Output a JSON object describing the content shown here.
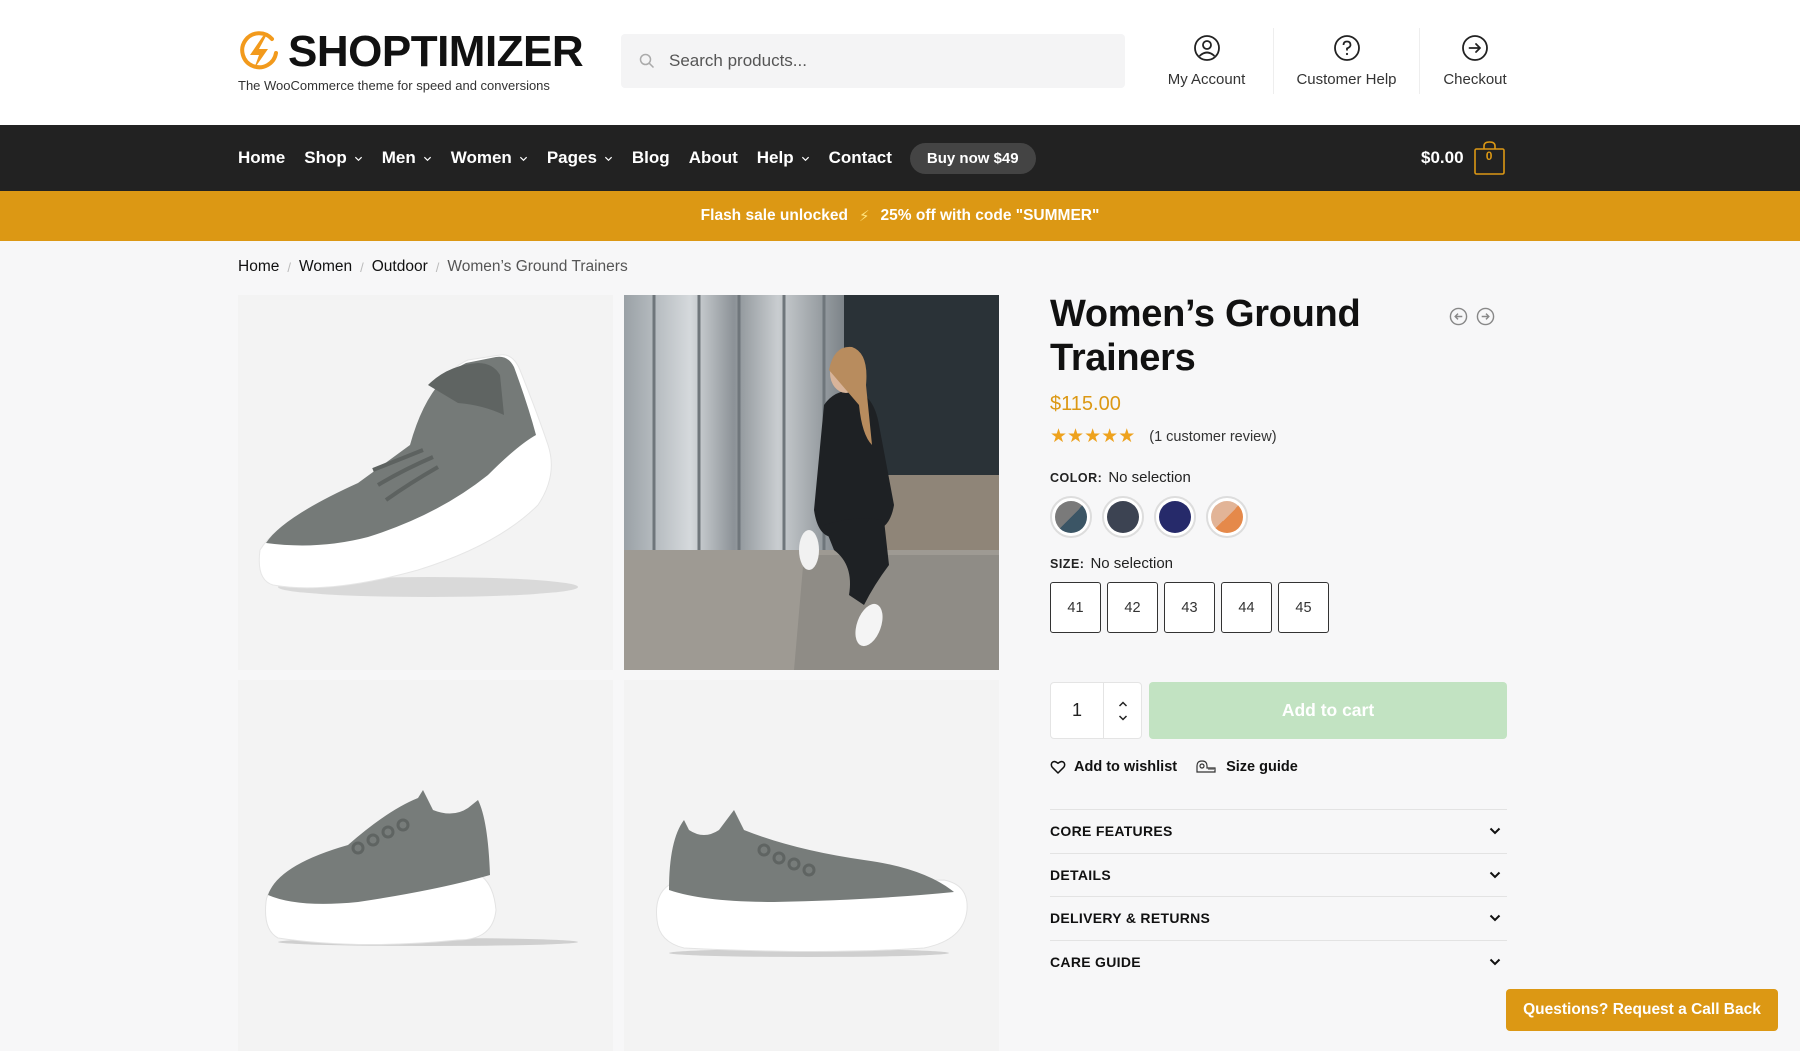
{
  "brand": {
    "name": "SHOPTIMIZER",
    "tagline": "The WooCommerce theme for speed and conversions",
    "logo_icon": "lightning-circle-icon",
    "accent_color": "#dc9814"
  },
  "search": {
    "placeholder": "Search products...",
    "value": "",
    "icon": "search-icon"
  },
  "header_links": [
    {
      "label": "My Account",
      "icon": "user-circle-icon"
    },
    {
      "label": "Customer Help",
      "icon": "help-circle-icon"
    },
    {
      "label": "Checkout",
      "icon": "arrow-right-circle-icon"
    }
  ],
  "nav": {
    "items": [
      {
        "label": "Home",
        "has_dropdown": false
      },
      {
        "label": "Shop",
        "has_dropdown": true
      },
      {
        "label": "Men",
        "has_dropdown": true
      },
      {
        "label": "Women",
        "has_dropdown": true
      },
      {
        "label": "Pages",
        "has_dropdown": true
      },
      {
        "label": "Blog",
        "has_dropdown": false
      },
      {
        "label": "About",
        "has_dropdown": false
      },
      {
        "label": "Help",
        "has_dropdown": true
      },
      {
        "label": "Contact",
        "has_dropdown": false
      }
    ],
    "buy_button": "Buy now $49",
    "cart_total": "$0.00",
    "cart_count": "0"
  },
  "flash_banner": {
    "left": "Flash sale unlocked",
    "icon": "⚡",
    "right": "25% off with code \"SUMMER\""
  },
  "breadcrumb": {
    "items": [
      "Home",
      "Women",
      "Outdoor"
    ],
    "current": "Women’s Ground Trainers",
    "separator": "/"
  },
  "gallery": {
    "images": [
      {
        "alt": "grey knit trainer angled view"
      },
      {
        "alt": "woman seated wearing white trainers"
      },
      {
        "alt": "grey knit trainer side view"
      },
      {
        "alt": "grey knit trainer inner side view"
      }
    ]
  },
  "product": {
    "title": "Women’s Ground Trainers",
    "price": "$115.00",
    "rating": 5,
    "rating_max": 5,
    "review_text": "(1 customer review)",
    "color": {
      "label": "COLOR:",
      "selection": "No selection",
      "swatches": [
        {
          "name": "grey-blue",
          "colors": [
            "#7a7a7a",
            "#3b5565"
          ]
        },
        {
          "name": "charcoal",
          "colors": [
            "#3c4352",
            "#3c4352"
          ]
        },
        {
          "name": "navy",
          "colors": [
            "#262a6a",
            "#262a6a"
          ]
        },
        {
          "name": "peach-orange",
          "colors": [
            "#e2b497",
            "#e5894a"
          ]
        }
      ]
    },
    "size": {
      "label": "SIZE:",
      "selection": "No selection",
      "options": [
        "41",
        "42",
        "43",
        "44",
        "45"
      ]
    },
    "quantity": "1",
    "add_to_cart": "Add to cart",
    "wishlist": "Add to wishlist",
    "size_guide": "Size guide",
    "accordion": [
      "CORE FEATURES",
      "DETAILS",
      "DELIVERY & RETURNS",
      "CARE GUIDE"
    ]
  },
  "callback_button": "Questions? Request a Call Back"
}
